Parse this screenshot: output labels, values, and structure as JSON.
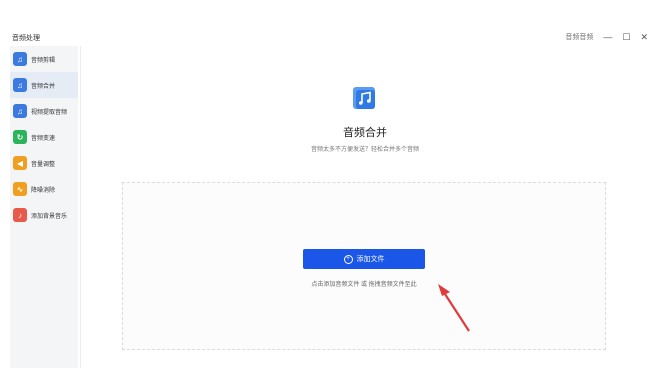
{
  "app": {
    "title": "音频处理",
    "right_link": "音频音频"
  },
  "window": {
    "minimize": "—",
    "maximize": "☐",
    "close": "✕"
  },
  "sidebar": {
    "items": [
      {
        "label": "音频剪辑",
        "color": "#3b7be0",
        "icon": "audio-cut-icon",
        "glyph": "♫",
        "active": false
      },
      {
        "label": "音频合并",
        "color": "#3b7be0",
        "icon": "audio-merge-icon",
        "glyph": "♫",
        "active": true
      },
      {
        "label": "视频提取音频",
        "color": "#3b7be0",
        "icon": "video-extract-icon",
        "glyph": "♫",
        "active": false
      },
      {
        "label": "音频变速",
        "color": "#2db35c",
        "icon": "speed-icon",
        "glyph": "↻",
        "active": false
      },
      {
        "label": "音量调整",
        "color": "#f0a020",
        "icon": "volume-icon",
        "glyph": "◀",
        "active": false
      },
      {
        "label": "降噪消除",
        "color": "#f0a020",
        "icon": "denoise-icon",
        "glyph": "∿",
        "active": false
      },
      {
        "label": "添加背景音乐",
        "color": "#e85a4a",
        "icon": "background-music-icon",
        "glyph": "♪",
        "active": false
      }
    ]
  },
  "main": {
    "title": "音频合并",
    "description": "音频太多不方便发送？轻松合并多个音频",
    "add_button": "添加文件",
    "drop_hint": "点击添加音频文件 或 拖拽音频文件至此"
  },
  "colors": {
    "accent": "#1a56e8",
    "arrow": "#e03a3a"
  }
}
